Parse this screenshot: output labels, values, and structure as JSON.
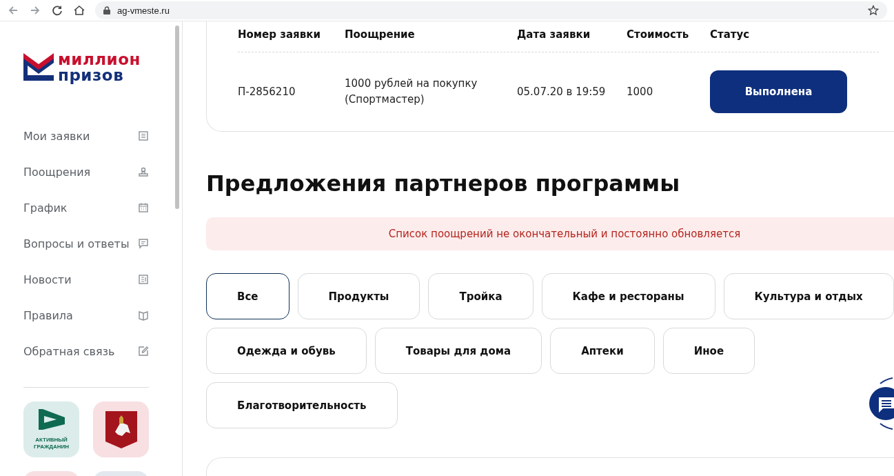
{
  "browser": {
    "address": "ag-vmeste.ru"
  },
  "logo": {
    "line_1": "миллион",
    "line_2": "призов"
  },
  "sidebar": {
    "items": [
      {
        "label": "Мои заявки",
        "kind": "list"
      },
      {
        "label": "Поощрения",
        "kind": "gift"
      },
      {
        "label": "График",
        "kind": "calendar"
      },
      {
        "label": "Вопросы и ответы",
        "kind": "chat"
      },
      {
        "label": "Новости",
        "kind": "news"
      },
      {
        "label": "Правила",
        "kind": "book"
      },
      {
        "label": "Обратная связь",
        "kind": "edit"
      }
    ],
    "apps": [
      {
        "kind": "citizen",
        "caption": "АКТИВНЫЙ ГРАЖДАНИН",
        "color": "#dcecea"
      },
      {
        "kind": "coat",
        "color": "#f7dfe2"
      },
      {
        "kind": "partial",
        "color": "#f7dfe2"
      },
      {
        "kind": "partial",
        "color": "#e3e7ee"
      }
    ]
  },
  "orders": {
    "columns": [
      "Номер заявки",
      "Поощрение",
      "Дата заявки",
      "Стоимость",
      "Статус"
    ],
    "rows": [
      {
        "number": "П-2856210",
        "reward": "1000 рублей на покупку (Спортмастер)",
        "date": "05.07.20 в 19:59",
        "cost": "1000",
        "status": "Выполнена"
      }
    ]
  },
  "partners": {
    "title": "Предложения партнеров программы",
    "notice": "Список поощрений не окончательный и постоянно обновляется",
    "filters": [
      [
        {
          "label": "Все",
          "selected": true
        },
        {
          "label": "Продукты",
          "selected": false
        },
        {
          "label": "Тройка",
          "selected": false
        },
        {
          "label": "Кафе и рестораны",
          "selected": false
        },
        {
          "label": "Культура и отдых",
          "selected": false
        }
      ],
      [
        {
          "label": "Одежда и обувь",
          "selected": false
        },
        {
          "label": "Товары для дома",
          "selected": false
        },
        {
          "label": "Аптеки",
          "selected": false
        },
        {
          "label": "Иное",
          "selected": false
        }
      ],
      [
        {
          "label": "Благотворительность",
          "selected": false
        }
      ]
    ]
  }
}
